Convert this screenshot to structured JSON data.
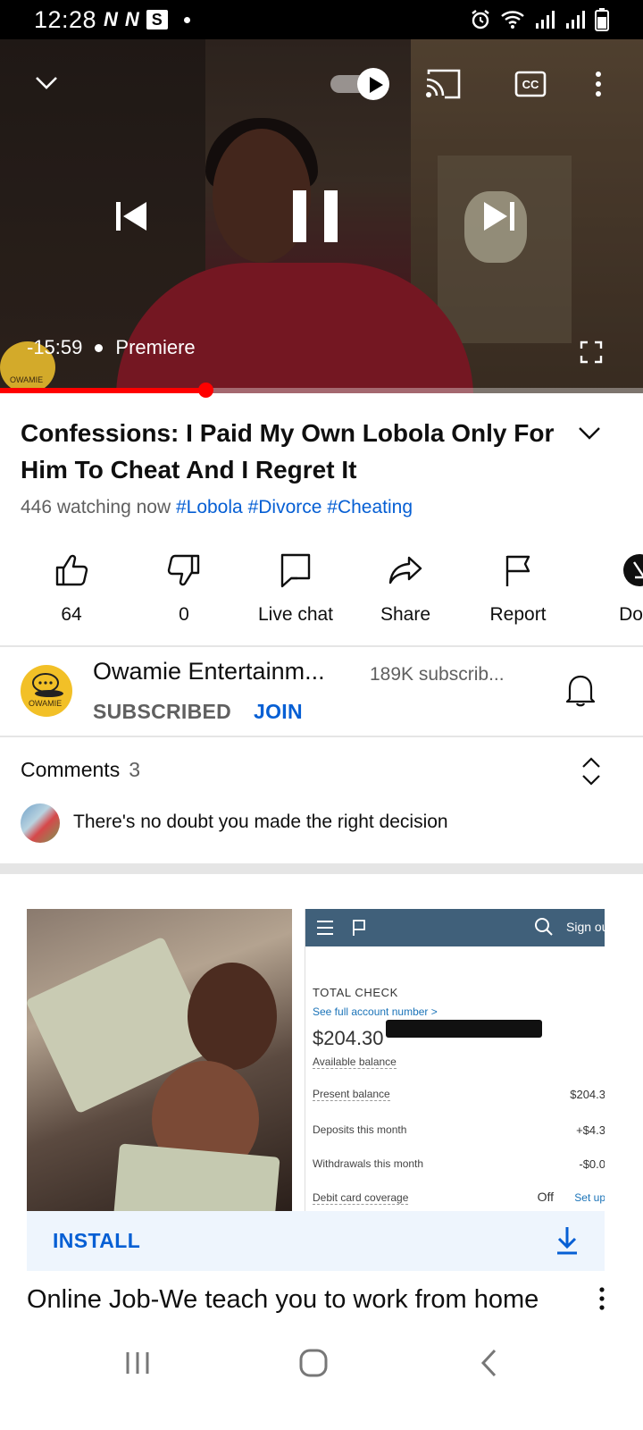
{
  "status_bar": {
    "time": "12:28",
    "notif_icons": [
      "N",
      "N",
      "S"
    ]
  },
  "player": {
    "time_remaining": "-15:59",
    "mode": "Premiere",
    "progress_fraction": 0.32,
    "channel_watermark": "OWAMIE"
  },
  "video": {
    "title": "Confessions: I Paid My Own Lobola Only For Him To Cheat And I Regret It",
    "watching": "446 watching now",
    "hashtags": [
      "#Lobola",
      "#Divorce",
      "#Cheating"
    ]
  },
  "actions": [
    {
      "icon": "thumbs-up-icon",
      "label": "64"
    },
    {
      "icon": "thumbs-down-icon",
      "label": "0"
    },
    {
      "icon": "live-chat-icon",
      "label": "Live chat"
    },
    {
      "icon": "share-icon",
      "label": "Share"
    },
    {
      "icon": "flag-icon",
      "label": "Report"
    },
    {
      "icon": "download-icon",
      "label": "Down"
    }
  ],
  "channel": {
    "name": "Owamie Entertainm...",
    "subscribers": "189K subscrib...",
    "subscribed_label": "SUBSCRIBED",
    "join_label": "JOIN",
    "avatar_text": "OWAMIE"
  },
  "comments": {
    "title": "Comments",
    "count": "3",
    "top_comment": "There's no doubt you made the right decision"
  },
  "ad": {
    "bank": {
      "signout": "Sign ou",
      "account_label": "TOTAL CHECK",
      "see_full": "See full account number >",
      "balance": "$204.30",
      "available": "Available balance",
      "rows": [
        {
          "label": "Present balance",
          "value": "$204.3"
        },
        {
          "label": "Deposits this month",
          "value": "+$4.3"
        },
        {
          "label": "Withdrawals this month",
          "value": "-$0.0"
        },
        {
          "label": "Debit card coverage",
          "value": "Off"
        }
      ],
      "setup": "Set up"
    },
    "install_label": "INSTALL",
    "title": "Online Job-We teach you to work from home"
  },
  "colors": {
    "accent": "#065fd4",
    "progress": "#ff0000",
    "secondary_text": "#606060"
  }
}
